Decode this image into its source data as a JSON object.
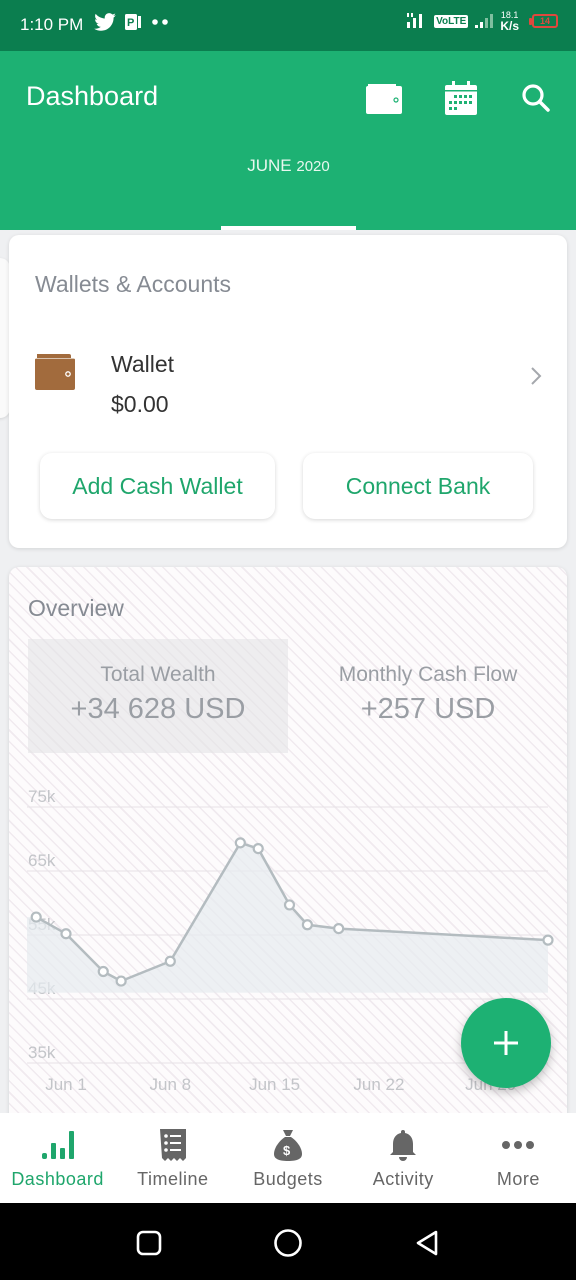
{
  "status_bar": {
    "time": "1:10 PM",
    "left_icons": [
      "twitter-icon",
      "pinterest-icon",
      "dots-icon"
    ],
    "volte": "VoLTE",
    "speed_value": "18.1",
    "speed_unit": "K/s",
    "battery": "14",
    "battery_color": "#e0483d"
  },
  "appbar": {
    "title": "Dashboard",
    "icons": [
      "wallet-icon",
      "calendar-icon",
      "search-icon"
    ],
    "month": "JUNE",
    "year": "2020",
    "brand_color": "#1db173",
    "status_color": "#0b7e4f"
  },
  "wallets": {
    "title": "Wallets & Accounts",
    "items": [
      {
        "name": "Wallet",
        "amount": "$0.00",
        "icon": "wallet-icon",
        "icon_color": "#a26b3d"
      }
    ],
    "buttons": {
      "add_cash": "Add Cash Wallet",
      "connect_bank": "Connect Bank"
    },
    "button_color": "#1fa66c"
  },
  "overview": {
    "title": "Overview",
    "stats": [
      {
        "label": "Total Wealth",
        "value": "+34 628 USD",
        "active": true
      },
      {
        "label": "Monthly Cash Flow",
        "value": "+257 USD",
        "active": false
      }
    ]
  },
  "chart_data": {
    "type": "area",
    "title": "",
    "xlabel": "",
    "ylabel": "",
    "x_tick_labels": [
      "Jun 1",
      "Jun 8",
      "Jun 15",
      "Jun 22",
      "Jun 29"
    ],
    "y_tick_labels": [
      "75k",
      "65k",
      "55k",
      "45k",
      "35k"
    ],
    "y_ticks": [
      75000,
      65000,
      55000,
      45000,
      35000
    ],
    "ylim": [
      35000,
      75000
    ],
    "grid": true,
    "series": [
      {
        "name": "Total Wealth",
        "x": [
          "May 31",
          "Jun 2",
          "Jun 4",
          "Jun 5",
          "Jun 8",
          "Jun 13",
          "Jun 14",
          "Jun 16",
          "Jun 17",
          "Jun 19",
          "Jun 30"
        ],
        "values": [
          57800,
          55200,
          49300,
          47800,
          50900,
          69400,
          68500,
          59700,
          56600,
          56000,
          54200
        ]
      }
    ],
    "x_positions_days": [
      -1,
      1,
      3.5,
      4.7,
      8,
      12.7,
      13.9,
      16,
      17.2,
      19.3,
      33.4
    ],
    "x_tick_days": [
      1,
      8,
      15,
      22,
      29.5
    ],
    "line_color": "#b4bcc0",
    "fill_color": "#e6ebef"
  },
  "fab": {
    "icon": "plus-icon"
  },
  "bottom_nav": {
    "items": [
      {
        "label": "Dashboard",
        "icon": "bar-chart-icon",
        "active": true
      },
      {
        "label": "Timeline",
        "icon": "receipt-icon",
        "active": false
      },
      {
        "label": "Budgets",
        "icon": "money-bag-icon",
        "active": false
      },
      {
        "label": "Activity",
        "icon": "bell-icon",
        "active": false
      },
      {
        "label": "More",
        "icon": "more-dots-icon",
        "active": false
      }
    ],
    "active_color": "#1fa66c",
    "inactive_color": "#666666"
  },
  "system_nav": [
    "recents-button",
    "home-button",
    "back-button"
  ]
}
